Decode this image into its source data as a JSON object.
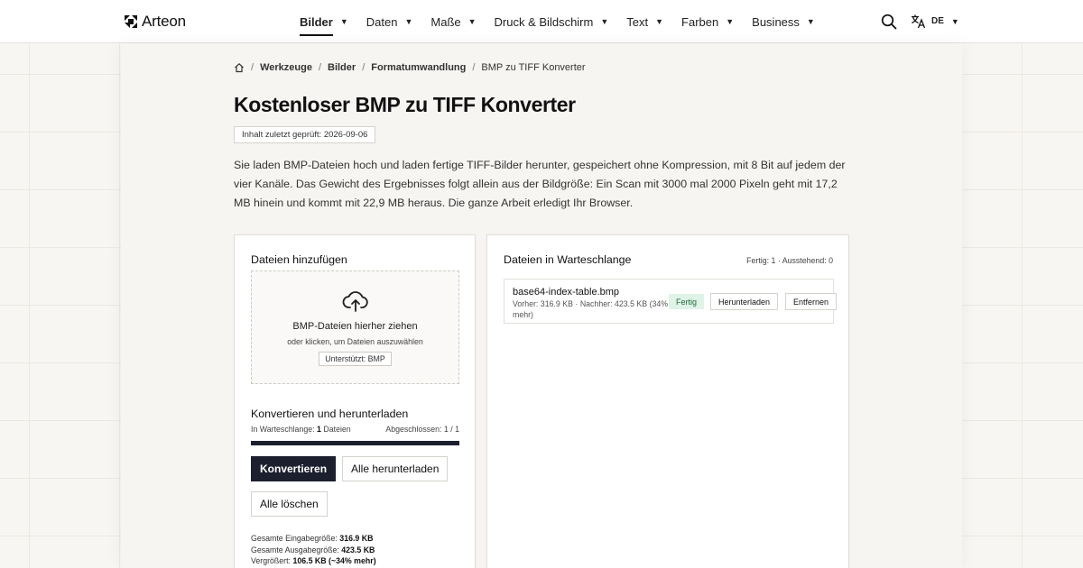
{
  "brand": {
    "name": "Arteon"
  },
  "nav": {
    "items": [
      {
        "label": "Bilder",
        "active": true
      },
      {
        "label": "Daten",
        "active": false
      },
      {
        "label": "Maße",
        "active": false
      },
      {
        "label": "Druck & Bildschirm",
        "active": false
      },
      {
        "label": "Text",
        "active": false
      },
      {
        "label": "Farben",
        "active": false
      },
      {
        "label": "Business",
        "active": false
      }
    ],
    "caret": "▼",
    "search_icon": "search-icon",
    "language": {
      "code": "DE",
      "icon": "translate-icon"
    }
  },
  "breadcrumb": {
    "home_icon": "home-icon",
    "separator": "/",
    "items": [
      "Werkzeuge",
      "Bilder",
      "Formatumwandlung"
    ],
    "current": "BMP zu TIFF Konverter"
  },
  "page": {
    "title": "Kostenloser BMP zu TIFF Konverter",
    "reviewed": "Inhalt zuletzt geprüft: 2026-09-06",
    "intro": "Sie laden BMP-Dateien hoch und laden fertige TIFF-Bilder herunter, gespeichert ohne Kompression, mit 8 Bit auf jedem der vier Kanäle. Das Gewicht des Ergebnisses folgt allein aus der Bildgröße: Ein Scan mit 3000 mal 2000 Pixeln geht mit 17,2 MB hinein und kommt mit 22,9 MB heraus. Die ganze Arbeit erledigt Ihr Browser."
  },
  "upload": {
    "title": "Dateien hinzufügen",
    "icon": "cloud-upload-icon",
    "drop_title": "BMP-Dateien hierher ziehen",
    "drop_sub": "oder klicken, um Dateien auszuwählen",
    "supported": "Unterstützt: BMP"
  },
  "convert": {
    "title": "Konvertieren und herunterladen",
    "queue_prefix": "In Warteschlange: ",
    "queue_count": "1",
    "queue_suffix": " Dateien",
    "completed": "Abgeschlossen: 1 / 1",
    "progress": 1.0,
    "convert_button": "Konvertieren",
    "download_all_button": "Alle herunterladen",
    "clear_button": "Alle löschen",
    "stats": [
      {
        "label": "Gesamte Eingabegröße: ",
        "value": "316.9 KB"
      },
      {
        "label": "Gesamte Ausgabegröße: ",
        "value": "423.5 KB"
      },
      {
        "label": "Vergrößert: ",
        "value": "106.5 KB (~34% mehr)"
      }
    ]
  },
  "queue": {
    "title": "Dateien in Warteschlange",
    "status": "Fertig: 1 · Ausstehend: 0",
    "files": [
      {
        "name": "base64-index-table.bmp",
        "meta": "Vorher: 316.9 KB · Nachher: 423.5 KB (34% mehr)",
        "status": "Fertig",
        "download": "Herunterladen",
        "remove": "Entfernen"
      }
    ]
  },
  "colors": {
    "accent": "#1c1f2e",
    "success_bg": "#dff3e7",
    "success_text": "#1e6b3c"
  }
}
